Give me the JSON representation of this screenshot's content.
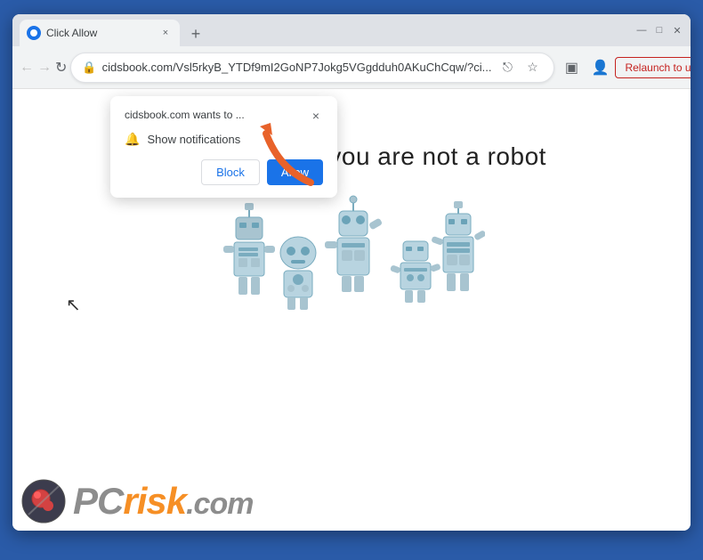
{
  "browser": {
    "tab": {
      "title": "Click Allow",
      "favicon": "browser-icon"
    },
    "new_tab_label": "+",
    "window_controls": {
      "minimize": "—",
      "maximize": "□",
      "close": "✕"
    },
    "nav": {
      "back": "←",
      "forward": "→",
      "refresh": "↻",
      "address": "cidsbook.com/Vsl5rkyB_YTDf9mI2GoNP7Jokg5VGgdduh0AKuChCqw/?ci...",
      "lock_icon": "🔒"
    },
    "toolbar": {
      "share": "⎋",
      "star": "☆",
      "extension": "▣",
      "profile": "👤",
      "relaunch_label": "Relaunch to update",
      "menu": "⋮"
    }
  },
  "notification_popup": {
    "site": "cidsbook.com wants to ...",
    "bell_icon": "🔔",
    "notification_label": "Show notifications",
    "allow_label": "Allow",
    "block_label": "Block",
    "close": "×"
  },
  "page": {
    "main_text": "Click \"Allow\"  if you are not   a robot"
  },
  "watermark": {
    "pc_text": "PC",
    "risk_text": "risk",
    "dot_com": ".com"
  },
  "colors": {
    "orange": "#f57c00",
    "blue_border": "#2a5ba8",
    "robot_body": "#a8c4d0",
    "arrow_orange": "#e8622a"
  }
}
